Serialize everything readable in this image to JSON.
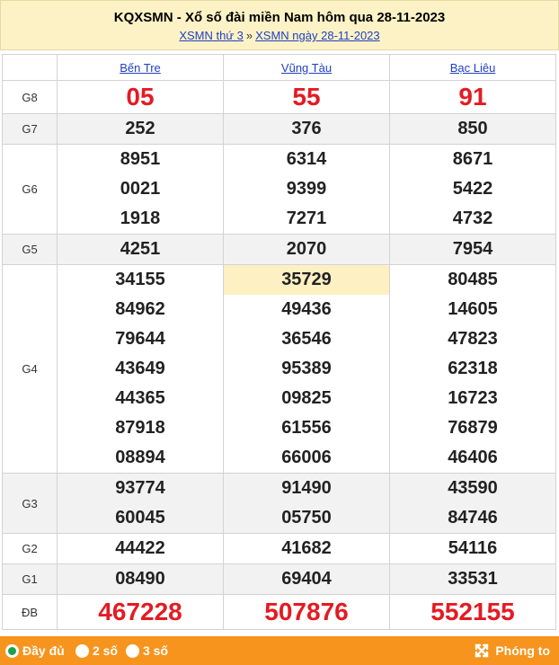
{
  "header": {
    "title": "KQXSMN - Xổ số đài miền Nam hôm qua 28-11-2023",
    "crumb_1": "XSMN thứ 3",
    "crumb_sep": "»",
    "crumb_2": "XSMN ngày 28-11-2023"
  },
  "provinces": [
    "Bến Tre",
    "Vũng Tàu",
    "Bạc Liêu"
  ],
  "prizes": {
    "g8": {
      "label": "G8",
      "values": [
        [
          "05"
        ],
        [
          "55"
        ],
        [
          "91"
        ]
      ]
    },
    "g7": {
      "label": "G7",
      "values": [
        [
          "252"
        ],
        [
          "376"
        ],
        [
          "850"
        ]
      ]
    },
    "g6": {
      "label": "G6",
      "values": [
        [
          "8951",
          "0021",
          "1918"
        ],
        [
          "6314",
          "9399",
          "7271"
        ],
        [
          "8671",
          "5422",
          "4732"
        ]
      ]
    },
    "g5": {
      "label": "G5",
      "values": [
        [
          "4251"
        ],
        [
          "2070"
        ],
        [
          "7954"
        ]
      ]
    },
    "g4": {
      "label": "G4",
      "values": [
        [
          "34155",
          "84962",
          "79644",
          "43649",
          "44365",
          "87918",
          "08894"
        ],
        [
          "35729",
          "49436",
          "36546",
          "95389",
          "09825",
          "61556",
          "66006"
        ],
        [
          "80485",
          "14605",
          "47823",
          "62318",
          "16723",
          "76879",
          "46406"
        ]
      ]
    },
    "g3": {
      "label": "G3",
      "values": [
        [
          "93774",
          "60045"
        ],
        [
          "91490",
          "05750"
        ],
        [
          "43590",
          "84746"
        ]
      ]
    },
    "g2": {
      "label": "G2",
      "values": [
        [
          "44422"
        ],
        [
          "41682"
        ],
        [
          "54116"
        ]
      ]
    },
    "g1": {
      "label": "G1",
      "values": [
        [
          "08490"
        ],
        [
          "69404"
        ],
        [
          "33531"
        ]
      ]
    },
    "db": {
      "label": "ĐB",
      "values": [
        [
          "467228"
        ],
        [
          "507876"
        ],
        [
          "552155"
        ]
      ]
    }
  },
  "footer": {
    "option_full": "Đầy đủ",
    "option_2": "2 số",
    "option_3": "3 số",
    "zoom_label": "Phóng to",
    "selected": "full"
  },
  "colors": {
    "header_bg": "#fdf2c5",
    "footer_bg": "#f7941d",
    "prize_red": "#e31b23",
    "link": "#1f3fc6"
  }
}
